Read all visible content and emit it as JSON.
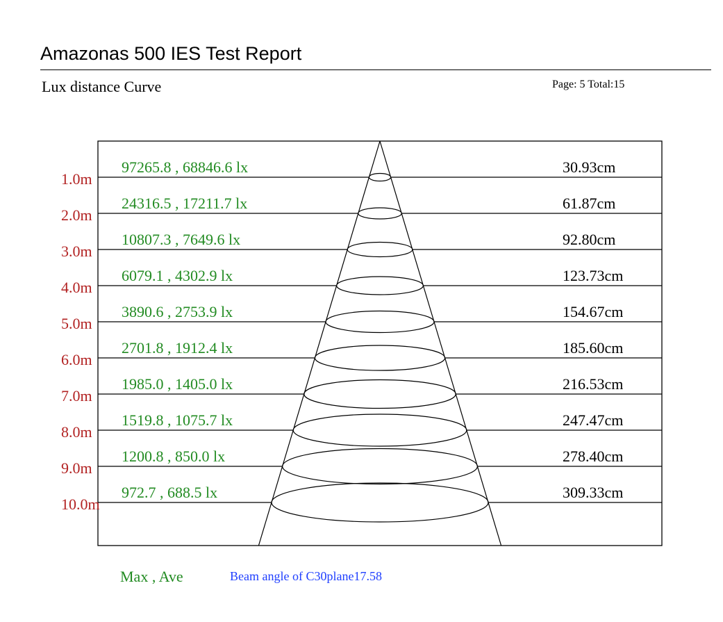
{
  "header": {
    "title": "Amazonas 500 IES Test Report",
    "section": "Lux distance Curve",
    "page_info": "Page: 5  Total:15"
  },
  "colors": {
    "distance_label": "#b22222",
    "lux_label": "#228b22",
    "beam_note": "#1f3fff",
    "lines": "#000000"
  },
  "chart_data": {
    "type": "table",
    "distance_unit": "m",
    "distances": [
      "1.0m",
      "2.0m",
      "3.0m",
      "4.0m",
      "5.0m",
      "6.0m",
      "7.0m",
      "8.0m",
      "9.0m",
      "10.0m"
    ],
    "lux_labels": [
      "97265.8 , 68846.6 lx",
      "24316.5 , 17211.7 lx",
      "10807.3 , 7649.6 lx",
      "6079.1 , 4302.9 lx",
      "3890.6 , 2753.9 lx",
      "2701.8 , 1912.4 lx",
      "1985.0 , 1405.0 lx",
      "1519.8 , 1075.7 lx",
      "1200.8 , 850.0 lx",
      "972.7 , 688.5 lx"
    ],
    "diameter_labels": [
      "30.93cm",
      "61.87cm",
      "92.80cm",
      "123.73cm",
      "154.67cm",
      "185.60cm",
      "216.53cm",
      "247.47cm",
      "278.40cm",
      "309.33cm"
    ],
    "distance_m": [
      1,
      2,
      3,
      4,
      5,
      6,
      7,
      8,
      9,
      10
    ],
    "max_lux": [
      97265.8,
      24316.5,
      10807.3,
      6079.1,
      3890.6,
      2701.8,
      1985.0,
      1519.8,
      1200.8,
      972.7
    ],
    "ave_lux": [
      68846.6,
      17211.7,
      7649.6,
      4302.9,
      2753.9,
      1912.4,
      1405.0,
      1075.7,
      850.0,
      688.5
    ],
    "diameter_cm": [
      30.93,
      61.87,
      92.8,
      123.73,
      154.67,
      185.6,
      216.53,
      247.47,
      278.4,
      309.33
    ],
    "legend": "Max , Ave",
    "beam_angle_text": "Beam angle of C30plane17.58"
  }
}
